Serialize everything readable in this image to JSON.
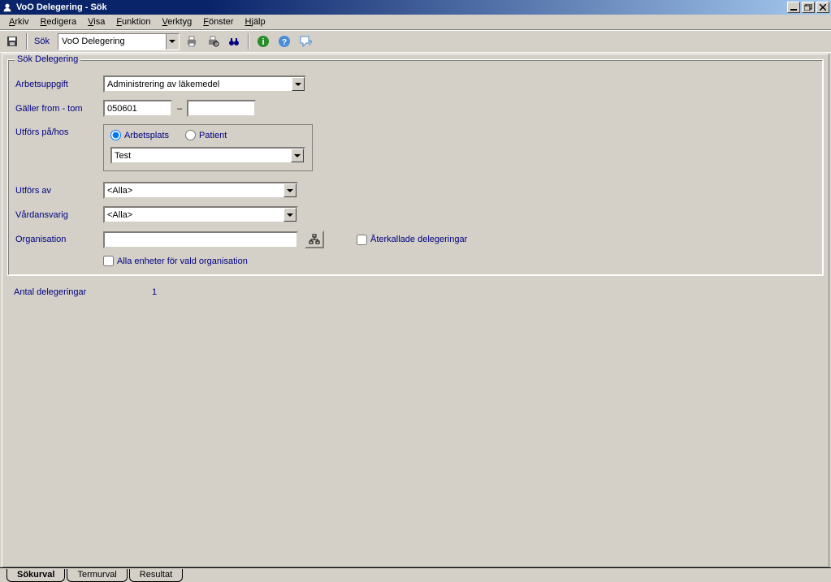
{
  "titlebar": {
    "title": "VoO Delegering - Sök"
  },
  "menubar": {
    "arkiv": "Arkiv",
    "redigera": "Redigera",
    "visa": "Visa",
    "funktion": "Funktion",
    "verktyg": "Verktyg",
    "fonster": "Fönster",
    "hjalp": "Hjälp"
  },
  "toolbar": {
    "sok_label": "Sök",
    "module_select": "VoO Delegering"
  },
  "group": {
    "legend": "Sök Delegering",
    "arbetsuppgift_label": "Arbetsuppgift",
    "arbetsuppgift_value": "Administrering av läkemedel",
    "galler_label": "Gäller from - tom",
    "galler_from": "050601",
    "galler_sep": "–",
    "galler_to": "",
    "utfors_pa_label": "Utförs på/hos",
    "radio_arbetsplats": "Arbetsplats",
    "radio_patient": "Patient",
    "arbetsplats_value": "Test",
    "utfors_av_label": "Utförs av",
    "utfors_av_value": "<Alla>",
    "vardansvarig_label": "Vårdansvarig",
    "vardansvarig_value": "<Alla>",
    "organisation_label": "Organisation",
    "organisation_value": "",
    "aterkallade_label": "Återkallade delegeringar",
    "alla_enheter_label": "Alla enheter för vald organisation"
  },
  "count": {
    "label": "Antal delegeringar",
    "value": "1"
  },
  "tabs": {
    "sokurval": "Sökurval",
    "termurval": "Termurval",
    "resultat": "Resultat"
  }
}
